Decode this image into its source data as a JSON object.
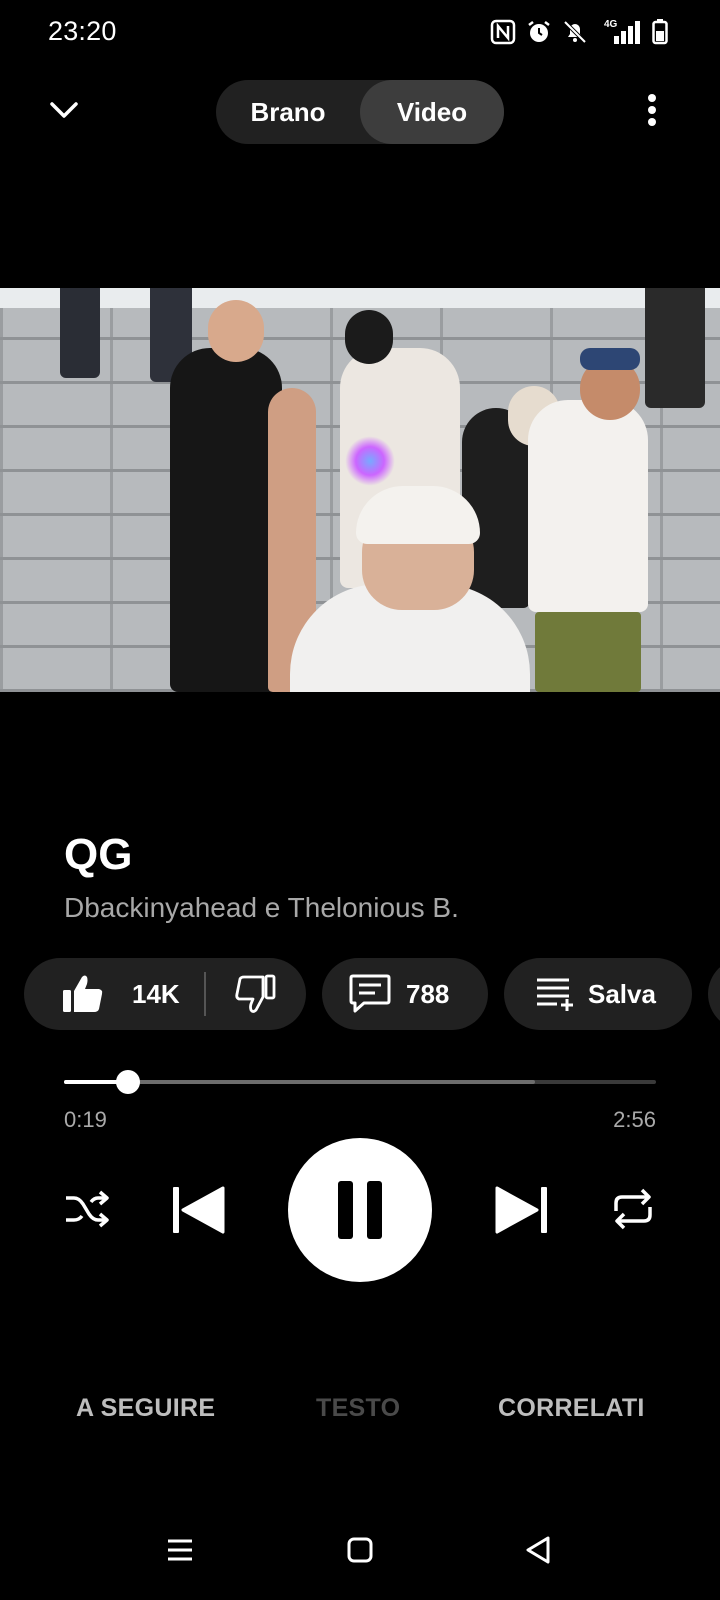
{
  "status_bar": {
    "time": "23:20",
    "icons": [
      "nfc-icon",
      "alarm-icon",
      "silent-bell-icon",
      "4g-signal-icon",
      "battery-icon"
    ],
    "network": "4G"
  },
  "header": {
    "toggle": {
      "song_label": "Brano",
      "video_label": "Video",
      "active": "video"
    }
  },
  "track": {
    "title": "QG",
    "artist": "Dbackinyahead e Thelonious B."
  },
  "actions": {
    "likes": "14K",
    "comments": "788",
    "save_label": "Salva"
  },
  "playback": {
    "current_time": "0:19",
    "total_time": "2:56",
    "played_fraction": 0.108,
    "buffered_fraction": 0.795,
    "state": "playing"
  },
  "tabs": {
    "up_next": "A SEGUIRE",
    "lyrics": "TESTO",
    "related": "CORRELATI"
  },
  "colors": {
    "background": "#000000",
    "pill": "#212121",
    "toggle_active": "#3d3d3d",
    "secondary_text": "#a8a8a8",
    "disabled_tab": "#4a4a4a"
  }
}
